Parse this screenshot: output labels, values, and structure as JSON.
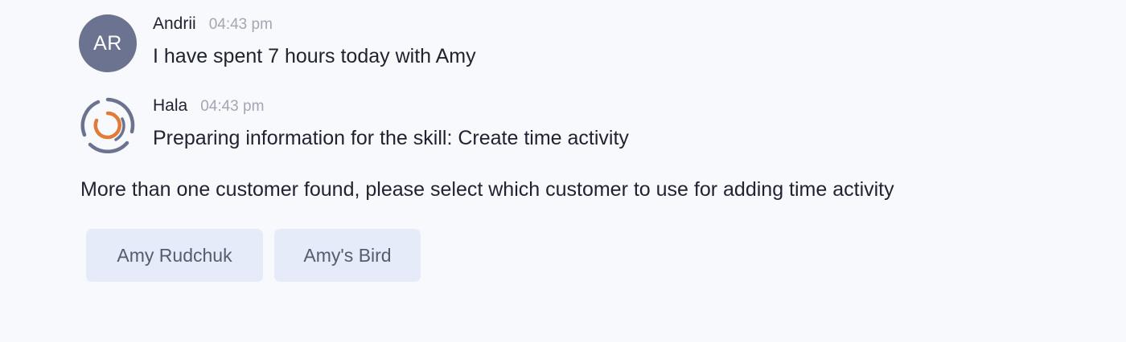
{
  "messages": [
    {
      "sender": "Andrii",
      "avatar_initials": "AR",
      "avatar_color": "#6b7391",
      "time": "04:43 pm",
      "text": "I have spent 7 hours today with Amy"
    },
    {
      "sender": "Hala",
      "avatar_icon": "hala-logo-icon",
      "time": "04:43 pm",
      "text": "Preparing information for the skill: Create time activity"
    }
  ],
  "prompt": "More than one customer found, please select which customer to use for adding time activity",
  "options": [
    {
      "label": "Amy Rudchuk"
    },
    {
      "label": "Amy's Bird"
    }
  ],
  "colors": {
    "background": "#f8f9fc",
    "option_bg": "#e6ebf9",
    "logo_orange": "#e07b39",
    "logo_slate": "#6b7391"
  }
}
